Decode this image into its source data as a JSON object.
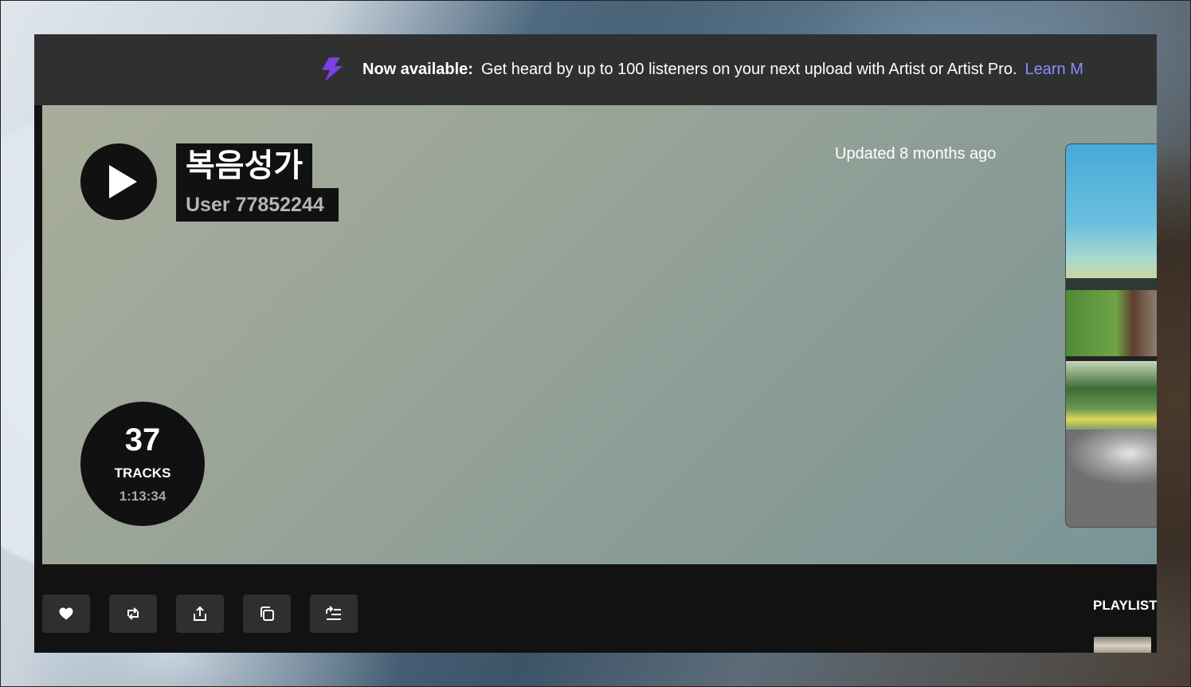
{
  "banner": {
    "icon": "lightning-bolt-icon",
    "icon_color": "#7b3fe4",
    "strong_text": "Now available:",
    "message": "Get heard by up to 100 listeners on your next upload with Artist or Artist Pro.",
    "link_text": "Learn M"
  },
  "playlist": {
    "title": "복음성가",
    "owner": "User 77852244",
    "updated": "Updated 8 months ago",
    "tracks_count": "37",
    "tracks_label": "TRACKS",
    "duration": "1:13:34"
  },
  "actions": {
    "like_icon": "heart-icon",
    "repost_icon": "repost-icon",
    "share_icon": "share-icon",
    "copy_icon": "copy-link-icon",
    "queue_icon": "add-to-queue-icon"
  },
  "sidebar": {
    "playlist_label": "PLAYLIST"
  },
  "colors": {
    "banner_bg": "#303030",
    "app_bg": "#121212",
    "link": "#8a8cff",
    "button_bg": "#2f2f2f"
  }
}
